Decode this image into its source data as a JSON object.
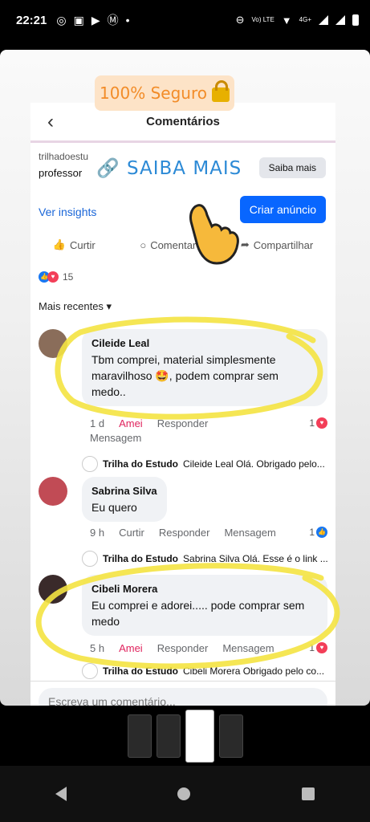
{
  "status_bar": {
    "time": "22:21",
    "net_label": "Vo) LTE",
    "signal_label": "4G+"
  },
  "sticker_secure": {
    "text": "100% Seguro"
  },
  "header": {
    "title": "Comentários"
  },
  "post": {
    "advertiser": "trilhadoestu",
    "advertiser_sub": "professor",
    "saiba_sticker": "SAIBA MAIS",
    "saiba_button": "Saiba mais",
    "insights_link": "Ver insights",
    "create_ad_button": "Criar anúncio",
    "actions": {
      "like": "Curtir",
      "comment": "Comentar",
      "share": "Compartilhar"
    },
    "reaction_count": "15",
    "sort_label": "Mais recentes"
  },
  "comments": [
    {
      "author": "Cileide Leal",
      "text_1": "Tbm comprei, material simplesmente",
      "text_2": "maravilhoso 🤩, podem comprar sem",
      "text_3": "medo..",
      "time": "1 d",
      "react_label": "Amei",
      "reply_label": "Responder",
      "message_label": "Mensagem",
      "count": "1",
      "reply_author": "Trilha do Estudo",
      "reply_text": "Cileide Leal Olá. Obrigado pelo..."
    },
    {
      "author": "Sabrina Silva",
      "text_1": "Eu quero",
      "time": "9 h",
      "react_label": "Curtir",
      "reply_label": "Responder",
      "message_label": "Mensagem",
      "count": "1",
      "reply_author": "Trilha do Estudo",
      "reply_text": "Sabrina Silva Olá. Esse é o link ..."
    },
    {
      "author": "Cibeli Morera",
      "text_1": "Eu comprei e adorei..... pode comprar sem",
      "text_2": "medo",
      "time": "5 h",
      "react_label": "Amei",
      "reply_label": "Responder",
      "message_label": "Mensagem",
      "count": "1",
      "reply_author": "Trilha do Estudo",
      "reply_text": "Cibeli Morera Obrigado pelo co..."
    }
  ],
  "compose": {
    "placeholder": "Escreva um comentário..."
  },
  "colors": {
    "accent": "#0866ff",
    "marker": "#f4e341",
    "love": "#f33e58"
  }
}
